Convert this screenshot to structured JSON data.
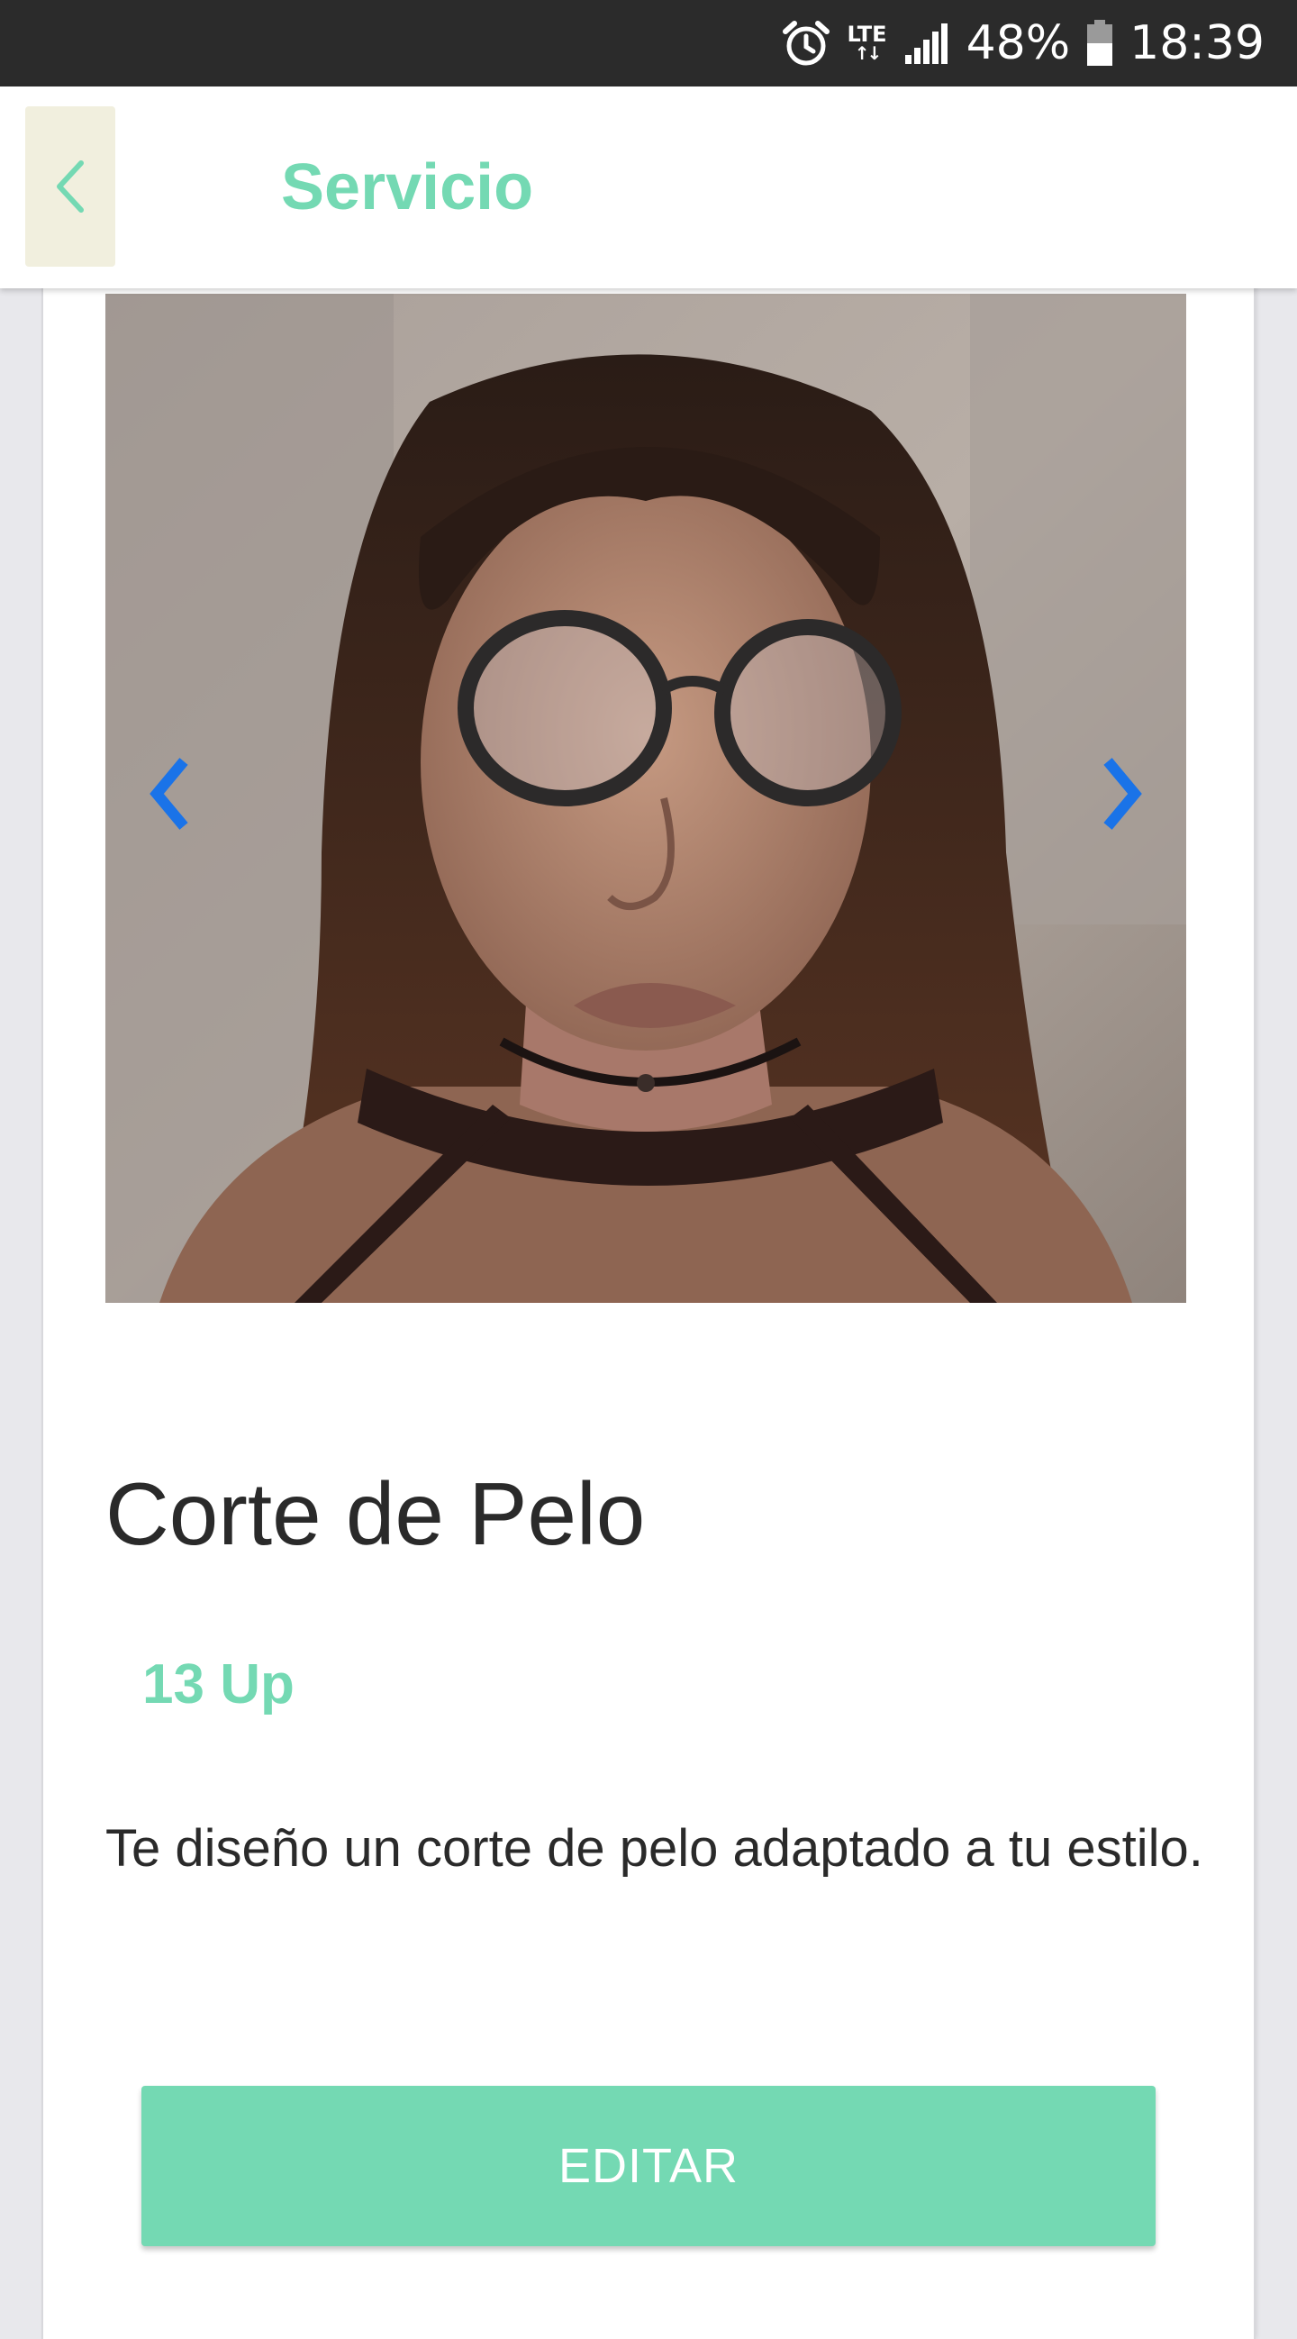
{
  "status_bar": {
    "network": "LTE",
    "network_arrows": "↑↓",
    "battery_percent": "48%",
    "time": "18:39",
    "icons": [
      "alarm-icon",
      "signal-icon",
      "battery-icon"
    ]
  },
  "app_bar": {
    "title": "Servicio",
    "back_icon": "chevron-left-icon"
  },
  "carousel": {
    "prev_icon": "chevron-left-icon",
    "next_icon": "chevron-right-icon",
    "arrow_color": "#1a73e8"
  },
  "service": {
    "title": "Corte de Pelo",
    "price": "13 Up",
    "description": "Te diseño un corte de pelo adaptado a tu estilo."
  },
  "actions": {
    "edit_label": "EDITAR"
  },
  "colors": {
    "accent": "#74d9b3",
    "back_button_bg": "#f1efde",
    "status_bar": "#2b2b2b"
  }
}
